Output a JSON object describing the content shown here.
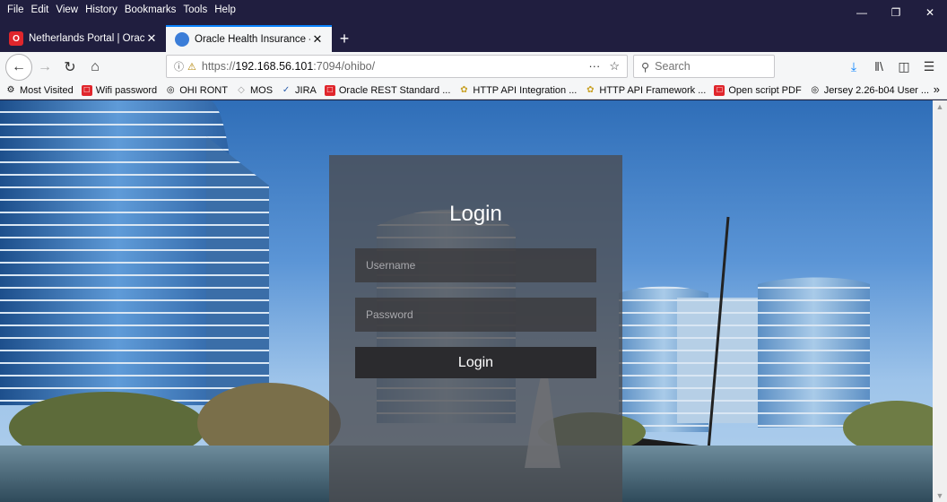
{
  "menubar": {
    "items": [
      "File",
      "Edit",
      "View",
      "History",
      "Bookmarks",
      "Tools",
      "Help"
    ]
  },
  "tabs": [
    {
      "title": "Netherlands Portal | Oracle",
      "icon": "oracle-icon",
      "active": false
    },
    {
      "title": "Oracle Health Insurance - Backo",
      "icon": "firefox-globe-icon",
      "active": true
    }
  ],
  "nav": {
    "url_prefix": "https://",
    "url_host": "192.168.56.101",
    "url_rest": ":7094/ohibo/",
    "search_placeholder": "Search",
    "more_label": "···"
  },
  "bookmarks": [
    {
      "label": "Most Visited",
      "icon": "gear-icon"
    },
    {
      "label": "Wifi password",
      "icon": "oracle-icon"
    },
    {
      "label": "OHI RONT",
      "icon": "globe-icon"
    },
    {
      "label": "MOS",
      "icon": "page-icon"
    },
    {
      "label": "JIRA",
      "icon": "jira-icon"
    },
    {
      "label": "Oracle REST Standard ...",
      "icon": "oracle-icon"
    },
    {
      "label": "HTTP API Integration ...",
      "icon": "puzzle-icon"
    },
    {
      "label": "HTTP API Framework ...",
      "icon": "puzzle-icon"
    },
    {
      "label": "Open script PDF",
      "icon": "oracle-icon"
    },
    {
      "label": "Jersey 2.26-b04 User ...",
      "icon": "globe-icon"
    }
  ],
  "login": {
    "title": "Login",
    "username_placeholder": "Username",
    "password_placeholder": "Password",
    "button_label": "Login"
  },
  "colors": {
    "accent": "#0a84ff",
    "oracle_red": "#e0262c",
    "titlebar": "#201e3f"
  }
}
